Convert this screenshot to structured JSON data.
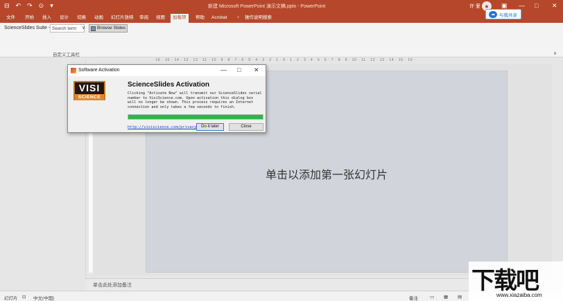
{
  "titlebar": {
    "title": "新建 Microsoft PowerPoint 演示文稿.pptx - PowerPoint",
    "user": "许 爱",
    "qat": [
      "⊟",
      "↶",
      "↷",
      "⊙",
      "▾"
    ],
    "controls": [
      "▣",
      "—",
      "□",
      "✕"
    ]
  },
  "tabs": [
    {
      "label": "文件"
    },
    {
      "label": "开始"
    },
    {
      "label": "插入"
    },
    {
      "label": "设计"
    },
    {
      "label": "切换"
    },
    {
      "label": "动画"
    },
    {
      "label": "幻灯片放映"
    },
    {
      "label": "审阅"
    },
    {
      "label": "视图"
    },
    {
      "label": "加载项"
    },
    {
      "label": "帮助"
    },
    {
      "label": "Acrobat"
    },
    {
      "label": "操作说明搜索"
    }
  ],
  "share": {
    "label": "与我共享"
  },
  "ribbon": {
    "suite_label": "ScienceSlides Suite -",
    "search_value": "Search term",
    "browse_label": "Browse Slides",
    "group_label": "自定义工具栏"
  },
  "ruler": {
    "labels": "· 16 · 15 · 14 · 13 · 12 · 11 · 10 · 9 · 8 · 7 · 6 · 5 · 4 · 3 · 2 · 1 · 0 · 1 · 2 · 3 · 4 · 5 · 6 · 7 · 8 · 9 · 10 · 11 · 12 · 13 · 14 · 15 · 16 ·"
  },
  "slide": {
    "title_placeholder": "单击以添加第一张幻灯片"
  },
  "notes": {
    "placeholder": "单击此处添加备注"
  },
  "status": {
    "slide_label": "幻灯片",
    "language": "中文(中国)",
    "notes_label": "备注"
  },
  "dialog": {
    "title": "Software Activation",
    "logo_top": "VISI",
    "logo_bottom": "SCIENCE",
    "heading": "ScienceSlides Activation",
    "body": "Clicking \"Activate Now\" will transmit our ScienceSlides serial number to VisiScience.com. Upon activation this dialog box will no longer be shown. This process requires an Internet connection and only takes a few seconds to finish.",
    "progress": 1.0,
    "link": "http://visiscience.com/privacy",
    "later_label": "Do it later",
    "close_label": "Close"
  },
  "watermark": {
    "logo": "下载吧",
    "url": "www.xiazaiba.com"
  },
  "colors": {
    "accent": "#b7472a",
    "progress": "#2fb34a",
    "link": "#1a3fd1"
  }
}
